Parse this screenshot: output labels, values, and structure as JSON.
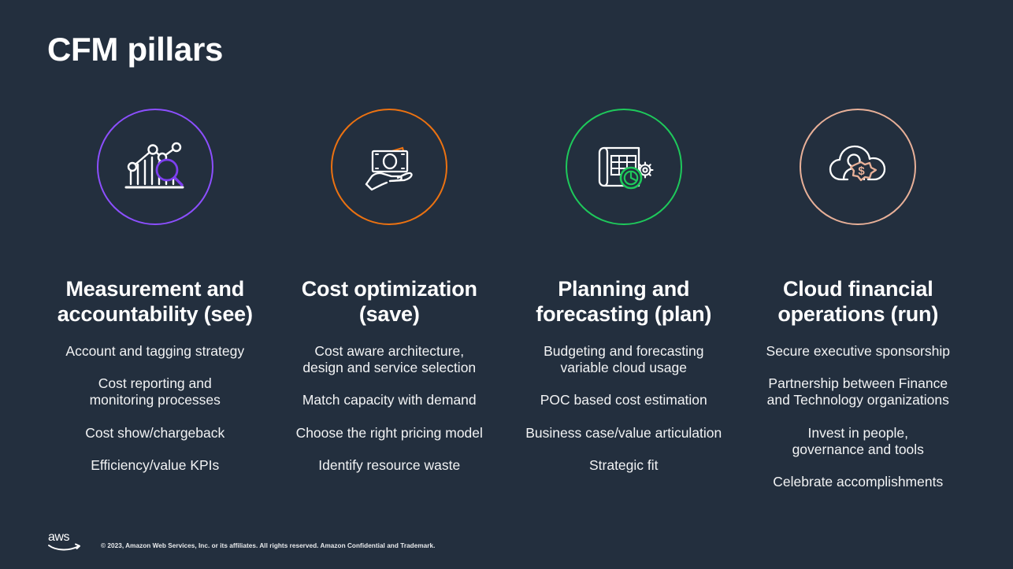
{
  "slide": {
    "title": "CFM pillars",
    "background_color": "#232f3e"
  },
  "pillars": [
    {
      "icon_name": "analytics-magnifier-icon",
      "ring_color": "#8c4fff",
      "heading_line1": "Measurement and",
      "heading_line2": "accountability (see)",
      "items": [
        {
          "line1": "Account and tagging strategy",
          "line2": ""
        },
        {
          "line1": "Cost reporting and",
          "line2": "monitoring processes"
        },
        {
          "line1": "Cost show/chargeback",
          "line2": ""
        },
        {
          "line1": "Efficiency/value KPIs",
          "line2": ""
        }
      ]
    },
    {
      "icon_name": "hand-holding-money-icon",
      "ring_color": "#ec7211",
      "heading_line1": "Cost",
      "heading_line2": "optimization (save)",
      "items": [
        {
          "line1": "Cost aware architecture,",
          "line2": "design and service selection"
        },
        {
          "line1": "Match capacity with demand",
          "line2": ""
        },
        {
          "line1": "Choose the right pricing model",
          "line2": ""
        },
        {
          "line1": "Identify resource waste",
          "line2": ""
        }
      ]
    },
    {
      "icon_name": "blueprint-gear-icon",
      "ring_color": "#1ec95b",
      "heading_line1": "Planning and",
      "heading_line2": "forecasting (plan)",
      "items": [
        {
          "line1": "Budgeting and forecasting",
          "line2": "variable cloud usage"
        },
        {
          "line1": "POC based cost estimation",
          "line2": ""
        },
        {
          "line1": "Business case/value articulation",
          "line2": ""
        },
        {
          "line1": "Strategic fit",
          "line2": ""
        }
      ]
    },
    {
      "icon_name": "cloud-person-dollar-gear-icon",
      "ring_color": "#e8b098",
      "heading_line1": "Cloud financial",
      "heading_line2": "operations (run)",
      "items": [
        {
          "line1": "Secure executive sponsorship",
          "line2": ""
        },
        {
          "line1": "Partnership between Finance",
          "line2": "and Technology organizations"
        },
        {
          "line1": "Invest in people,",
          "line2": "governance and tools"
        },
        {
          "line1": "Celebrate accomplishments",
          "line2": ""
        }
      ]
    }
  ],
  "footer": {
    "logo_name": "aws-logo",
    "logo_text": "aws",
    "copyright": "© 2023, Amazon Web Services, Inc. or its affiliates. All rights reserved. Amazon Confidential and Trademark."
  }
}
